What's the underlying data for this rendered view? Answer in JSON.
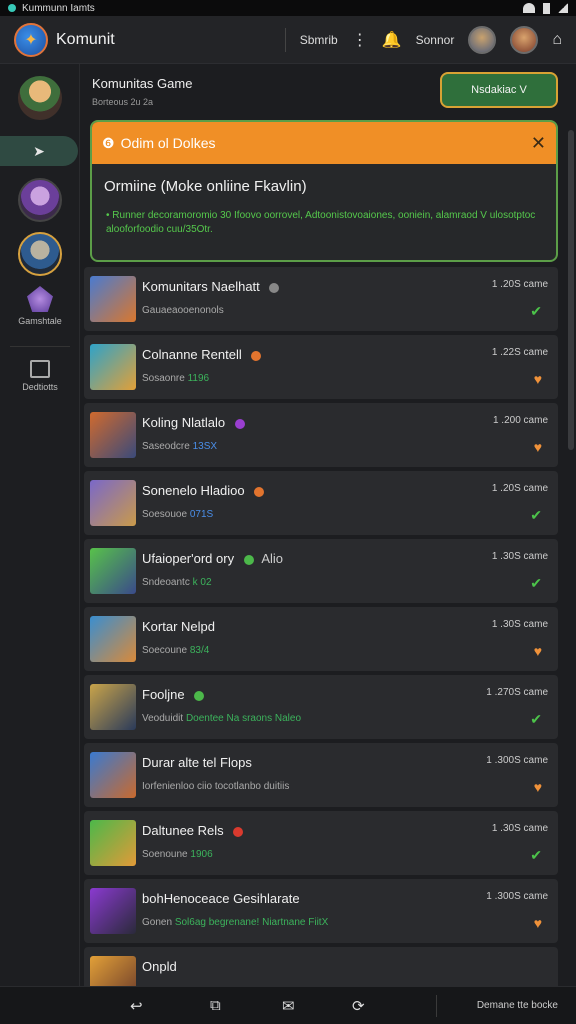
{
  "status_bar": {
    "app_label": "Kummunn Iamts"
  },
  "header": {
    "app_name": "Komunit",
    "link_1": "Sbmrib",
    "link_2": "Sonnor",
    "icons": {
      "menu": "menu-icon",
      "notify": "notification-icon",
      "person": "person-icon"
    }
  },
  "sidebar": {
    "items": [
      {
        "label": "Gamshtale"
      },
      {
        "label": "Dedtiotts"
      }
    ]
  },
  "main": {
    "title": "Komunitas Game",
    "subtitle": "Borteous 2u 2a",
    "cta_label": "Nsdakiac V"
  },
  "notice": {
    "header": "Odim ol Dolkes",
    "title": "Ormiine (Moke onliine Fkavlin)",
    "body": "• Runner decoramoromio 30 Ifoovo oorrovel, Adtoonistovoaiones, ooniein, alamraod V ulosotptoc alooforfoodio cuu/35Otr."
  },
  "games": [
    {
      "name": "Komunitars Naelhatt",
      "sub_a": "Gauaeaooenonols",
      "sub_b": "",
      "count": "1 .20S",
      "unit": "came",
      "status": "green",
      "thumb": [
        "#4a7bd0",
        "#d9772e"
      ],
      "badge": "#888"
    },
    {
      "name": "Colnanne Rentell",
      "sub_a": "Sosaonre",
      "sub_b": "1196",
      "count": "1 .22S",
      "unit": "came",
      "status": "orange",
      "thumb": [
        "#2ea3c9",
        "#e2a038"
      ],
      "badge": "#e2742e"
    },
    {
      "name": "Koling Nlatlalo",
      "sub_a": "Saseodcre",
      "sub_b": "13SX",
      "count": "1 .200",
      "unit": "came",
      "status": "orange",
      "thumb": [
        "#d06a2e",
        "#3a4a7a"
      ],
      "badge": "#9a3fd0"
    },
    {
      "name": "Sonenelo Hladioo",
      "sub_a": "Soesouoe",
      "sub_b": "071S",
      "count": "1 .20S",
      "unit": "came",
      "status": "green",
      "thumb": [
        "#7a68c9",
        "#c99a4a"
      ],
      "badge": "#e2742e"
    },
    {
      "name": "Ufaioper'ord ory",
      "sub_a": "Sndeoantc",
      "sub_b": "k 02",
      "count": "1 .30S",
      "unit": "came",
      "status": "green",
      "thumb": [
        "#58c24a",
        "#3a4a8a"
      ],
      "badge": "#4cb84a",
      "tail": "Alio"
    },
    {
      "name": "Kortar Nelpd",
      "sub_a": "Soecoune",
      "sub_b": "83/4",
      "count": "1 .30S",
      "unit": "came",
      "status": "orange",
      "thumb": [
        "#3a8ed0",
        "#d98a3a"
      ],
      "badge": ""
    },
    {
      "name": "Fooljne",
      "sub_a": "Veoduidit",
      "sub_b": "Doentee Na sraons Naleo",
      "count": "1 .270S",
      "unit": "came",
      "status": "green",
      "thumb": [
        "#c9a44a",
        "#2a3a5a"
      ],
      "badge": "#4cb84a"
    },
    {
      "name": "Durar alte tel Flops",
      "sub_a": "Iorfenienloo ciio tocotlanbo duitiis",
      "sub_b": "",
      "count": "1 .300S",
      "unit": "came",
      "status": "orange",
      "thumb": [
        "#3a7ad0",
        "#c96a2e"
      ],
      "badge": ""
    },
    {
      "name": "Daltunee Rels",
      "sub_a": "Soenoune",
      "sub_b": "1906",
      "count": "1 .30S",
      "unit": "came",
      "status": "green",
      "thumb": [
        "#4cb84a",
        "#e29a38"
      ],
      "badge": "#d93a2e"
    },
    {
      "name": "bohHenoceace Gesihlarate",
      "sub_a": "Gonen",
      "sub_b": "Sol6ag begrenane! Niartnane FiitX",
      "count": "1 .300S",
      "unit": "came",
      "status": "orange",
      "thumb": [
        "#8a3ad0",
        "#2a2a3a"
      ],
      "badge": ""
    },
    {
      "name": "Onpld",
      "sub_a": "",
      "sub_b": "",
      "count": "",
      "unit": "",
      "status": "",
      "thumb": [
        "#e2a038",
        "#6a3a2a"
      ],
      "badge": ""
    }
  ],
  "bottom_bar": {
    "icons": [
      "back-icon",
      "cards-icon",
      "message-icon",
      "refresh-icon"
    ],
    "label": "Demane tte bocke"
  }
}
